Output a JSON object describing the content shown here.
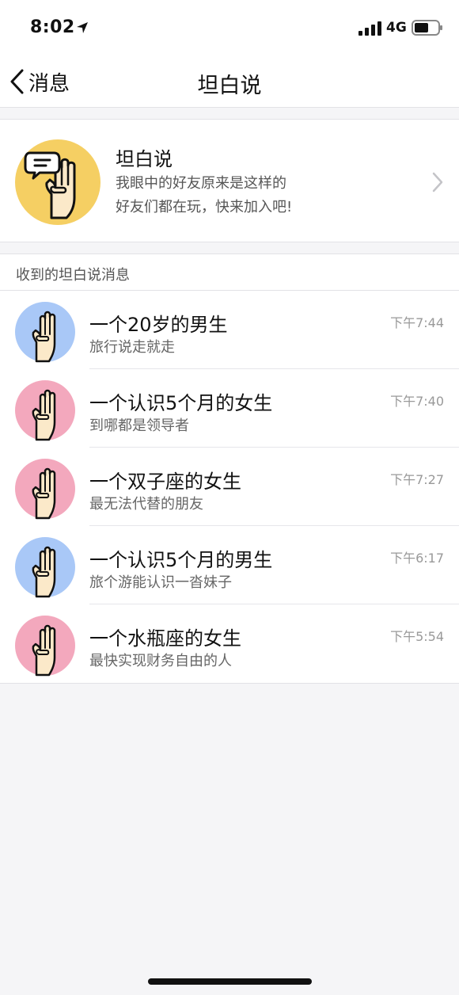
{
  "status_bar": {
    "time": "8:02",
    "network": "4G",
    "icons": [
      "location-arrow-icon",
      "signal-bars-icon",
      "battery-icon"
    ]
  },
  "nav": {
    "back_label": "消息",
    "title": "坦白说"
  },
  "feature": {
    "title": "坦白说",
    "line1": "我眼中的好友原来是这样的",
    "line2": "好友们都在玩，快来加入吧!",
    "avatar_color": "#f5cf63"
  },
  "section": {
    "header": "收到的坦白说消息"
  },
  "colors": {
    "male_avatar": "#a9c8f7",
    "female_avatar": "#f3a8bd",
    "hand_fill": "#fbe9c9",
    "outline": "#111111"
  },
  "messages": [
    {
      "title": "一个20岁的男生",
      "subtitle": "旅行说走就走",
      "time": "下午7:44",
      "gender": "male"
    },
    {
      "title": "一个认识5个月的女生",
      "subtitle": "到哪都是领导者",
      "time": "下午7:40",
      "gender": "female"
    },
    {
      "title": "一个双子座的女生",
      "subtitle": "最无法代替的朋友",
      "time": "下午7:27",
      "gender": "female"
    },
    {
      "title": "一个认识5个月的男生",
      "subtitle": "旅个游能认识一沓妹子",
      "time": "下午6:17",
      "gender": "male"
    },
    {
      "title": "一个水瓶座的女生",
      "subtitle": "最快实现财务自由的人",
      "time": "下午5:54",
      "gender": "female"
    }
  ]
}
